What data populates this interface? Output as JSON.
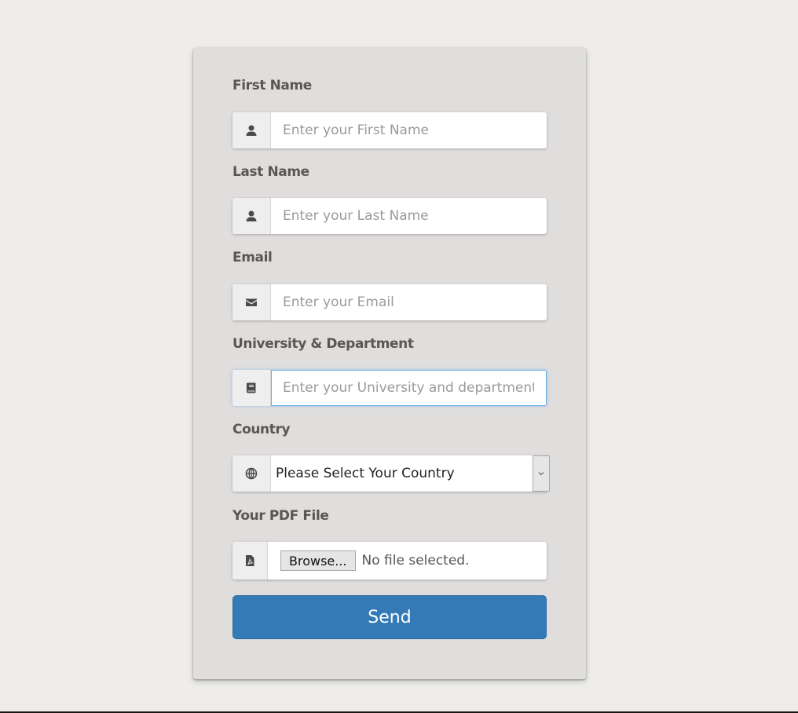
{
  "form": {
    "fields": [
      {
        "label": "First Name",
        "placeholder": "Enter your First Name",
        "icon": "user-icon"
      },
      {
        "label": "Last Name",
        "placeholder": "Enter your Last Name",
        "icon": "user-icon"
      },
      {
        "label": "Email",
        "placeholder": "Enter your Email",
        "icon": "envelope-icon"
      },
      {
        "label": "University & Department",
        "placeholder": "Enter your University and department name",
        "icon": "book-icon"
      }
    ],
    "country": {
      "label": "Country",
      "selected": "Please Select Your Country",
      "icon": "globe-icon"
    },
    "pdf": {
      "label": "Your PDF File",
      "browse_label": "Browse...",
      "status": "No file selected.",
      "icon": "file-pdf-icon"
    },
    "send_label": "Send"
  },
  "colors": {
    "primary": "#337ab7",
    "card": "#e0dddd",
    "background": "#eeedeb"
  }
}
